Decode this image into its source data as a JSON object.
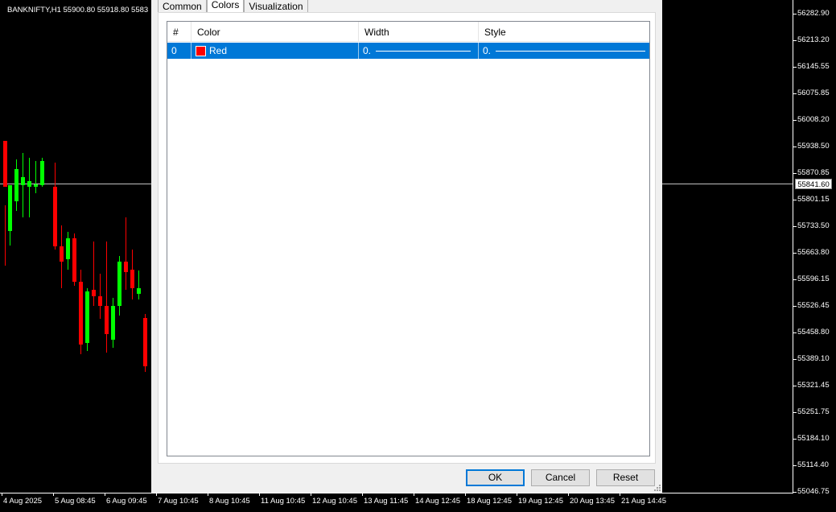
{
  "chart": {
    "title": "BANKNIFTY,H1  55900.80 55918.80 5583",
    "crosshair_price": "55841.60",
    "price_labels": [
      "56282.90",
      "56213.20",
      "56145.55",
      "56075.85",
      "56008.20",
      "55938.50",
      "55870.85",
      "55801.15",
      "55733.50",
      "55663.80",
      "55596.15",
      "55526.45",
      "55458.80",
      "55389.10",
      "55321.45",
      "55251.75",
      "55184.10",
      "55114.40",
      "55046.75"
    ],
    "time_labels": [
      "4 Aug 2025",
      "5 Aug 08:45",
      "6 Aug 09:45",
      "7 Aug 10:45",
      "8 Aug 10:45",
      "11 Aug 10:45",
      "12 Aug 10:45",
      "13 Aug 11:45",
      "14 Aug 12:45",
      "18 Aug 12:45",
      "19 Aug 12:45",
      "20 Aug 13:45",
      "21 Aug 14:45"
    ],
    "colors": {
      "bull": "#00ff00",
      "bear": "#ff0000",
      "background": "#000000",
      "crosshair": "#c0c0c0"
    }
  },
  "dialog": {
    "tabs": [
      {
        "label": "Common",
        "active": false
      },
      {
        "label": "Colors",
        "active": true
      },
      {
        "label": "Visualization",
        "active": false
      }
    ],
    "grid": {
      "headers": {
        "index": "#",
        "color": "Color",
        "width": "Width",
        "style": "Style"
      },
      "rows": [
        {
          "index": "0",
          "color_name": "Red",
          "color_hex": "#ff0000",
          "width": "0.",
          "style": "0."
        }
      ]
    },
    "buttons": {
      "ok": "OK",
      "cancel": "Cancel",
      "reset": "Reset"
    },
    "colors": {
      "selection": "#0078d7"
    }
  }
}
